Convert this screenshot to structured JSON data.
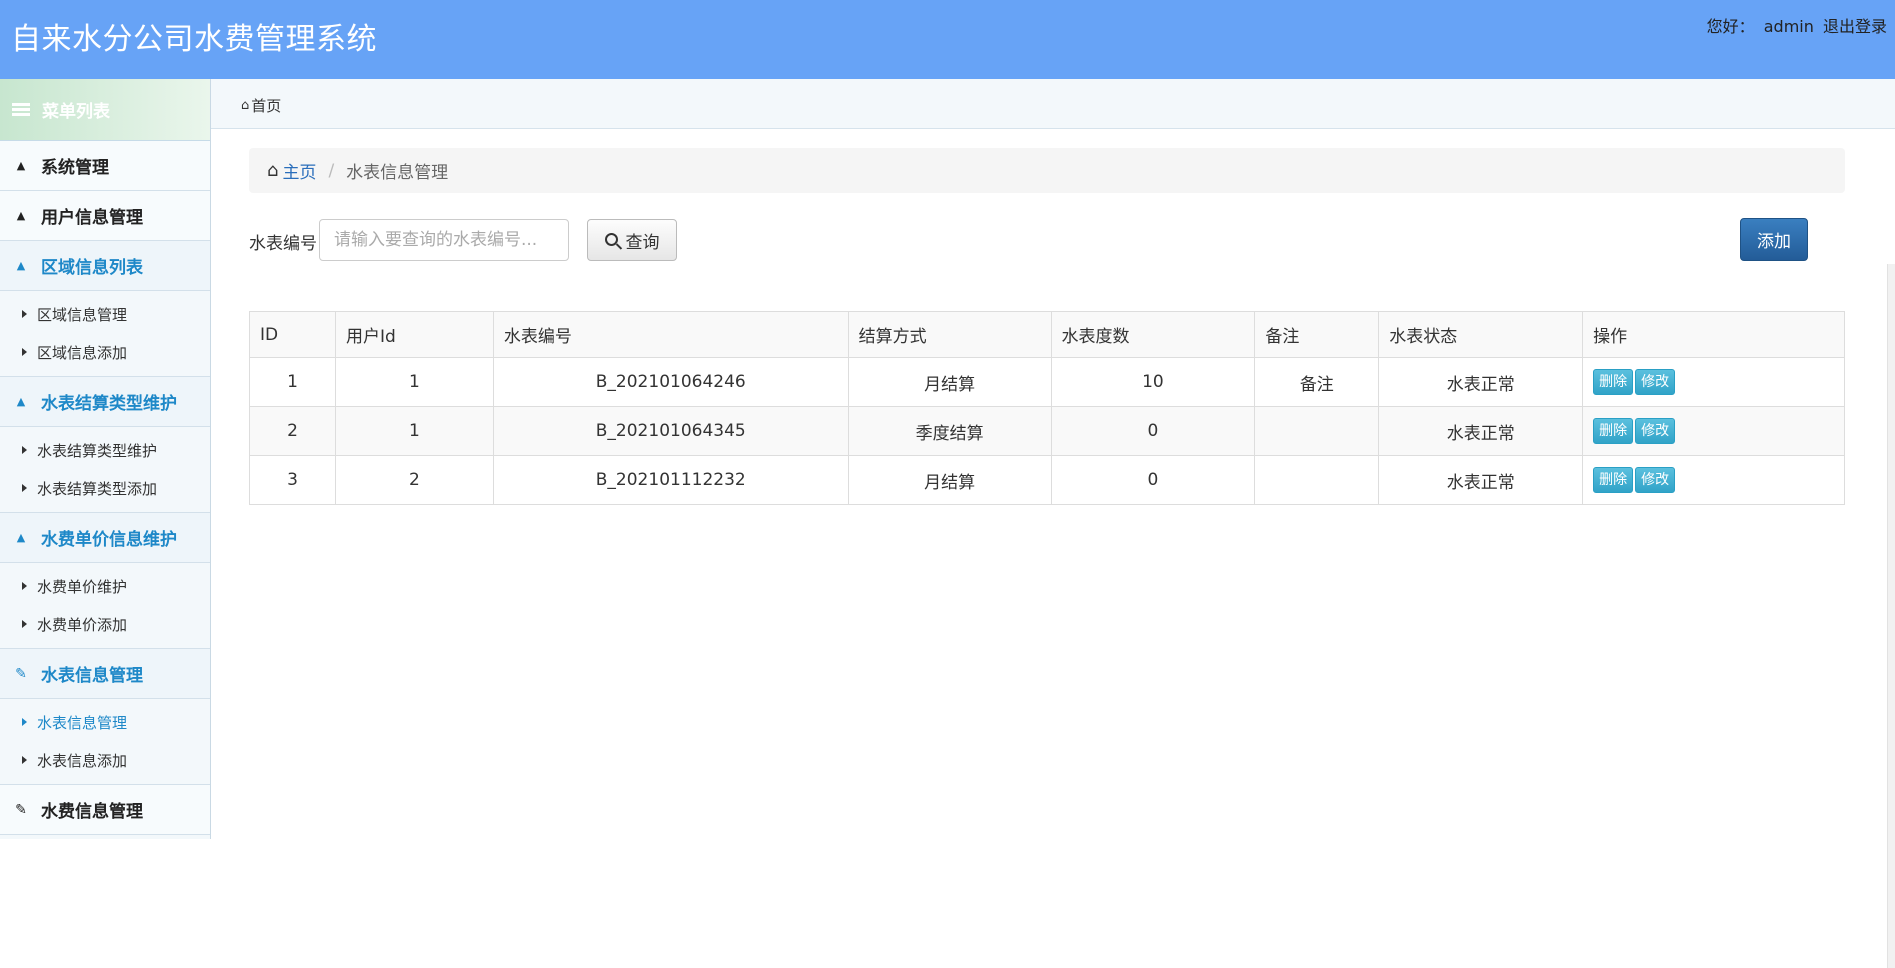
{
  "header": {
    "title": "自来水分公司水费管理系统",
    "greeting": "您好：",
    "username": "admin",
    "logout": "退出登录",
    "bg_color": "#67a3f6"
  },
  "sidebar": {
    "menu_title": "菜单列表",
    "groups": [
      {
        "label": "系统管理",
        "icon": "user-icon",
        "active": false,
        "items": []
      },
      {
        "label": "用户信息管理",
        "icon": "user-icon",
        "active": false,
        "items": []
      },
      {
        "label": "区域信息列表",
        "icon": "user-icon",
        "active": true,
        "items": [
          "区域信息管理",
          "区域信息添加"
        ]
      },
      {
        "label": "水表结算类型维护",
        "icon": "user-icon",
        "active": true,
        "items": [
          "水表结算类型维护",
          "水表结算类型添加"
        ]
      },
      {
        "label": "水费单价信息维护",
        "icon": "user-icon",
        "active": true,
        "items": [
          "水费单价维护",
          "水费单价添加"
        ]
      },
      {
        "label": "水表信息管理",
        "icon": "edit-icon",
        "active": true,
        "items": [
          "水表信息管理",
          "水表信息添加"
        ]
      },
      {
        "label": "水费信息管理",
        "icon": "edit-icon",
        "active": false,
        "items": []
      }
    ],
    "active_item": "水表信息管理",
    "accent": "#1e88c8"
  },
  "tabbar": {
    "home_tab": "首页"
  },
  "breadcrumb": {
    "home": "主页",
    "current": "水表信息管理"
  },
  "search": {
    "label": "水表编号",
    "placeholder": "请输入要查询的水表编号...",
    "value": "",
    "button": "查询"
  },
  "add_button": "添加",
  "table": {
    "headers": [
      "ID",
      "用户Id",
      "水表编号",
      "结算方式",
      "水表度数",
      "备注",
      "水表状态",
      "操作"
    ],
    "rows": [
      {
        "id": "1",
        "user_id": "1",
        "meter_no": "B_202101064246",
        "settle": "月结算",
        "reading": "10",
        "note": "备注",
        "status": "水表正常"
      },
      {
        "id": "2",
        "user_id": "1",
        "meter_no": "B_202101064345",
        "settle": "季度结算",
        "reading": "0",
        "note": "",
        "status": "水表正常"
      },
      {
        "id": "3",
        "user_id": "2",
        "meter_no": "B_202101112232",
        "settle": "月结算",
        "reading": "0",
        "note": "",
        "status": "水表正常"
      }
    ],
    "delete_label": "删除",
    "edit_label": "修改"
  }
}
